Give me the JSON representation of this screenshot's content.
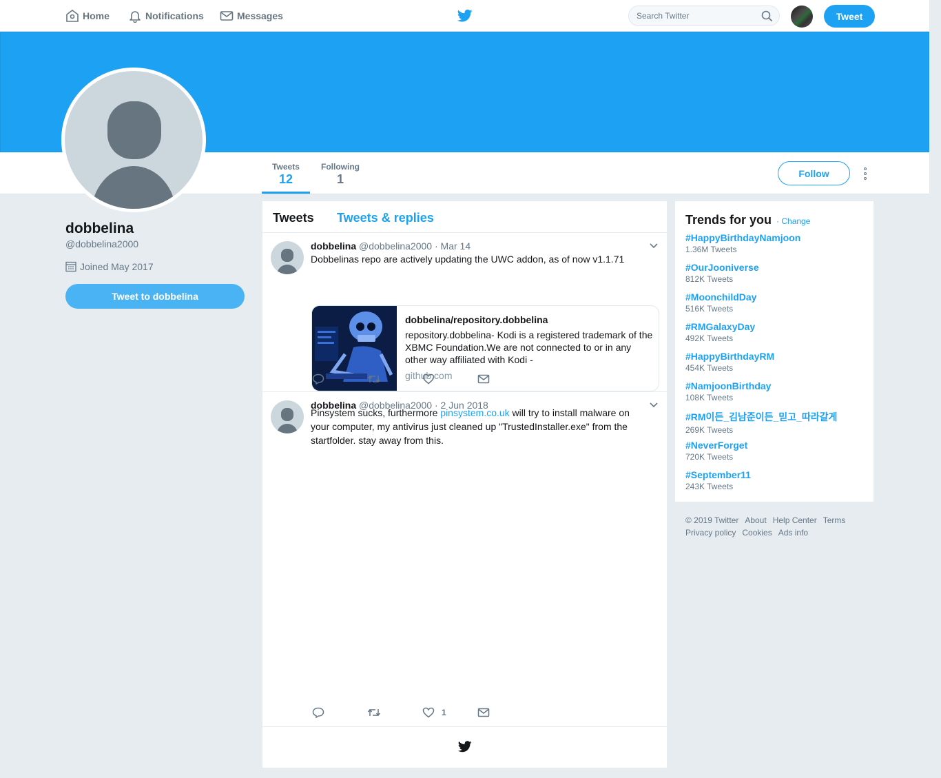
{
  "nav": {
    "home": "Home",
    "notifications": "Notifications",
    "messages": "Messages",
    "search_placeholder": "Search Twitter",
    "tweet_button": "Tweet"
  },
  "profile": {
    "name": "dobbelina",
    "handle": "@dobbelina2000",
    "joined": "Joined May 2017",
    "tweet_to": "Tweet to dobbelina",
    "follow_button": "Follow",
    "stats": [
      {
        "label": "Tweets",
        "value": "12"
      },
      {
        "label": "Following",
        "value": "1"
      }
    ]
  },
  "timeline": {
    "tabs": [
      "Tweets",
      "Tweets & replies"
    ],
    "tweets": [
      {
        "name": "dobbelina",
        "handle": "@dobbelina2000",
        "date": "· Mar 14",
        "text": "Dobbelinas repo are actively updating the UWC addon, as of now v1.1.71",
        "card": {
          "title": "dobbelina/repository.dobbelina",
          "description": "repository.dobbelina- Kodi is a registered trademark of the XBMC Foundation.We are not connected to or in any other way affiliated with Kodi - dobbelina/repository.dobbelina",
          "domain": "github.com"
        },
        "likes": ""
      },
      {
        "name": "dobbelina",
        "handle": "@dobbelina2000",
        "date": "· 2 Jun 2018",
        "text_before": "Pinsystem sucks, furthermore ",
        "link": "pinsystem.co.uk",
        "text_after": " will try to install malware on your computer, my antivirus just cleaned up \"TrustedInstaller.exe\" from the startfolder. stay away from this.",
        "likes": "1"
      }
    ]
  },
  "trends": {
    "title": "Trends for you",
    "change": "· Change",
    "items": [
      {
        "tag": "#HappyBirthdayNamjoon",
        "count": "1.36M Tweets"
      },
      {
        "tag": "#OurJooniverse",
        "count": "812K Tweets"
      },
      {
        "tag": "#MoonchildDay",
        "count": "516K Tweets"
      },
      {
        "tag": "#RMGalaxyDay",
        "count": "492K Tweets"
      },
      {
        "tag": "#HappyBirthdayRM",
        "count": "454K Tweets"
      },
      {
        "tag": "#NamjoonBirthday",
        "count": "108K Tweets"
      },
      {
        "tag": "#RM이든_김남준이든_믿고_따라갈게",
        "count": "269K Tweets"
      },
      {
        "tag": "#NeverForget",
        "count": "720K Tweets"
      },
      {
        "tag": "#September11",
        "count": "243K Tweets"
      }
    ]
  },
  "footer": {
    "links": [
      "© 2019 Twitter",
      "About",
      "Help Center",
      "Terms",
      "Privacy policy",
      "Cookies",
      "Ads info"
    ]
  },
  "colors": {
    "brand": "#1da1f2",
    "background": "#e6ecf0",
    "secondary_text": "#657786"
  }
}
